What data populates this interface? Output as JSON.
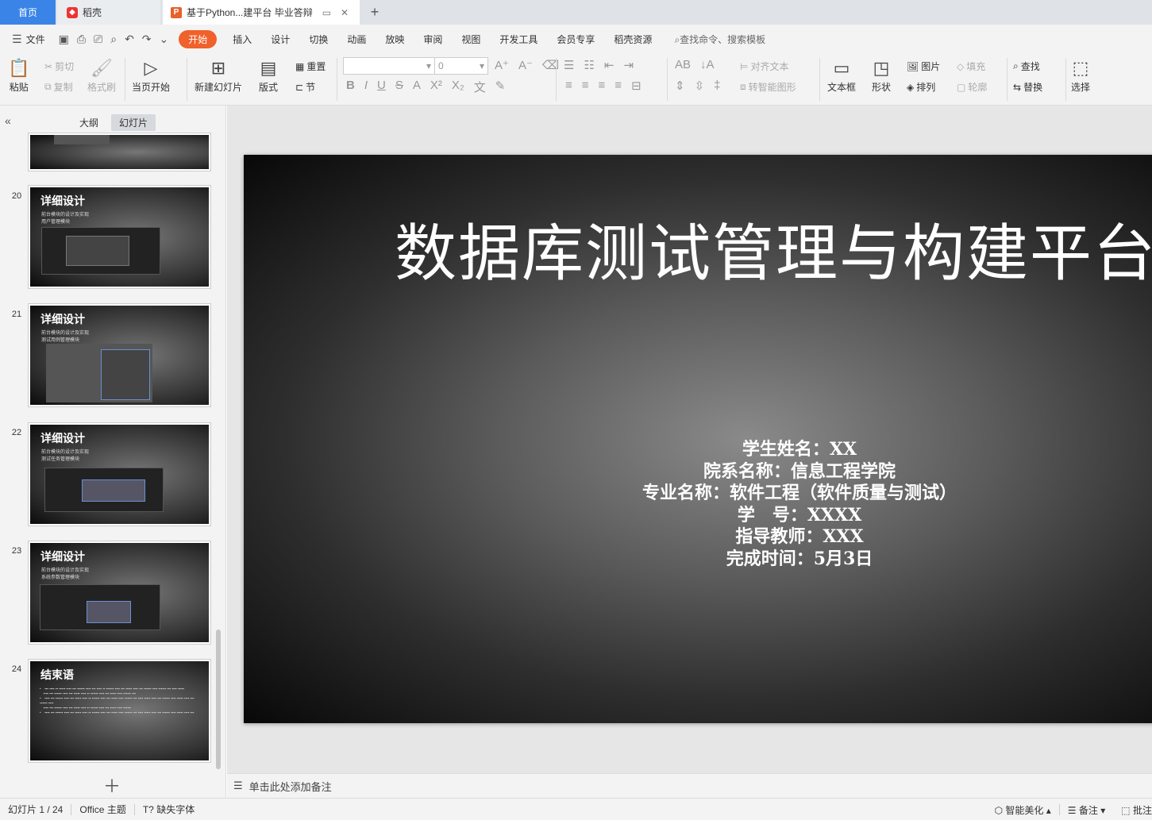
{
  "tabs": {
    "home": "首页",
    "daoke": "稻壳",
    "doc": "基于Python...建平台 毕业答辩",
    "add": "+"
  },
  "menu": {
    "file": "文件",
    "items": [
      "开始",
      "插入",
      "设计",
      "切换",
      "动画",
      "放映",
      "审阅",
      "视图",
      "开发工具",
      "会员专享",
      "稻壳资源"
    ],
    "active_index": 0,
    "search": "查找命令、搜索模板"
  },
  "ribbon": {
    "paste": "粘贴",
    "cut": "剪切",
    "copy": "复制",
    "format_painter": "格式刷",
    "from_current": "当页开始",
    "new_slide": "新建幻灯片",
    "layout": "版式",
    "reset": "重置",
    "section": "节",
    "font_size": "0",
    "align_text": "对齐文本",
    "smart_art": "转智能图形",
    "textbox": "文本框",
    "shape": "形状",
    "picture": "图片",
    "arrange": "排列",
    "fill": "填充",
    "outline": "轮廓",
    "find": "查找",
    "replace": "替换",
    "select": "选择"
  },
  "panel": {
    "outline_tab": "大纲",
    "slides_tab": "幻灯片",
    "thumbnails": [
      {
        "num": "20",
        "title": "详细设计",
        "sub1": "前台模块的设计及实现",
        "sub2": "用户管理模块"
      },
      {
        "num": "21",
        "title": "详细设计",
        "sub1": "前台模块的设计及实现",
        "sub2": "测试用例管理模块"
      },
      {
        "num": "22",
        "title": "详细设计",
        "sub1": "前台模块的设计及实现",
        "sub2": "测试任务管理模块"
      },
      {
        "num": "23",
        "title": "详细设计",
        "sub1": "前台模块的设计及实现",
        "sub2": "系统参数管理模块"
      },
      {
        "num": "24",
        "title": "结束语",
        "sub1": "",
        "sub2": ""
      }
    ]
  },
  "slide": {
    "title": "数据库测试管理与构建平台",
    "lines": [
      "学生姓名：XX",
      "院系名称：信息工程学院",
      "专业名称：软件工程（软件质量与测试）",
      "学　号：XXXX",
      "指导教师：XXX",
      "完成时间：5月3日"
    ]
  },
  "notes": {
    "placeholder": "单击此处添加备注"
  },
  "status": {
    "slide_count": "幻灯片 1 / 24",
    "theme": "Office 主题",
    "missing_font": "缺失字体",
    "beautify": "智能美化",
    "notes": "备注",
    "comment": "批注"
  }
}
